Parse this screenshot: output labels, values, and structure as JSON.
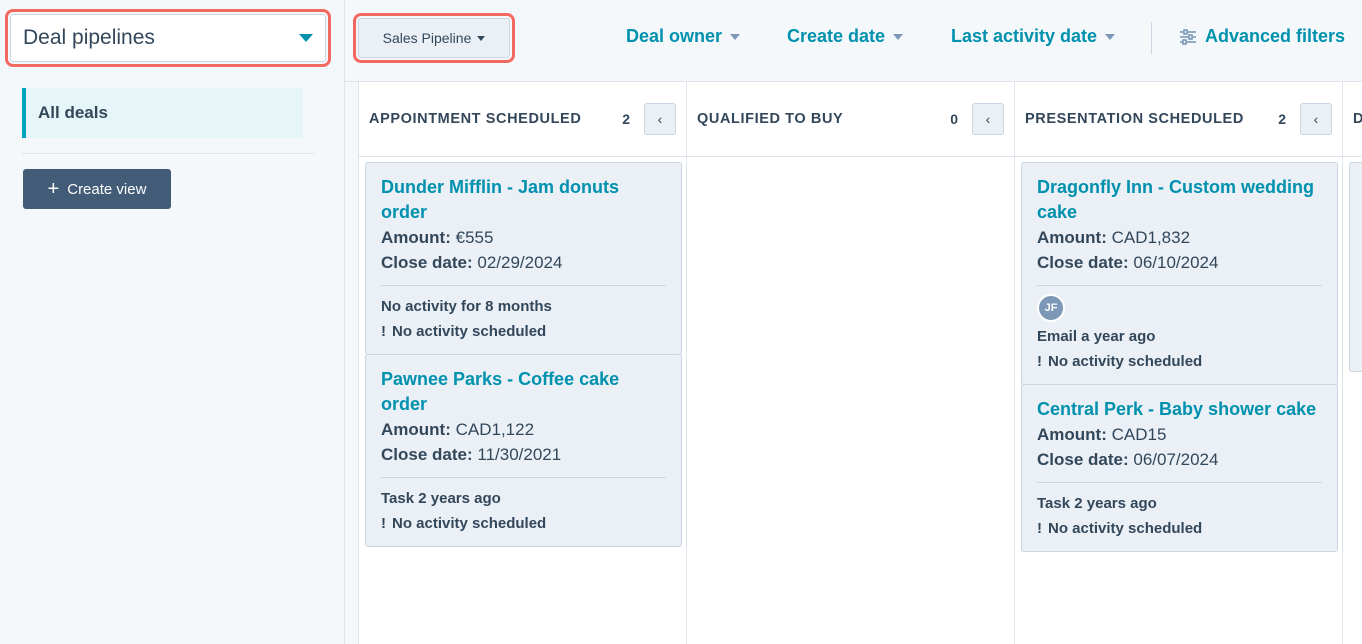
{
  "sidebar": {
    "pipeline_select": "Deal pipelines",
    "view_item": "All deals",
    "create_view": "Create view"
  },
  "topbar": {
    "pipeline": "Sales Pipeline",
    "filters": [
      "Deal owner",
      "Create date",
      "Last activity date"
    ],
    "advanced": "Advanced filters"
  },
  "labels": {
    "amount": "Amount:",
    "close_date": "Close date:"
  },
  "columns": [
    {
      "title": "APPOINTMENT SCHEDULED",
      "count": "2",
      "cards": [
        {
          "title": "Dunder Mifflin - Jam donuts order",
          "amount": "€555",
          "close": "02/29/2024",
          "activity": "No activity for 8 months",
          "scheduled": "No activity scheduled"
        },
        {
          "title": "Pawnee Parks - Coffee cake order",
          "amount": "CAD1,122",
          "close": "11/30/2021",
          "activity": "Task 2 years ago",
          "scheduled": "No activity scheduled"
        }
      ]
    },
    {
      "title": "QUALIFIED TO BUY",
      "count": "0",
      "cards": []
    },
    {
      "title": "PRESENTATION SCHEDULED",
      "count": "2",
      "cards": [
        {
          "title": "Dragonfly Inn - Custom wedding cake",
          "amount": "CAD1,832",
          "close": "06/10/2024",
          "avatar": "JF",
          "activity": "Email a year ago",
          "scheduled": "No activity scheduled"
        },
        {
          "title": "Central Perk - Baby shower cake",
          "amount": "CAD15",
          "close": "06/07/2024",
          "activity": "Task 2 years ago",
          "scheduled": "No activity scheduled"
        }
      ]
    },
    {
      "title": "D",
      "count": "",
      "cards": []
    }
  ]
}
